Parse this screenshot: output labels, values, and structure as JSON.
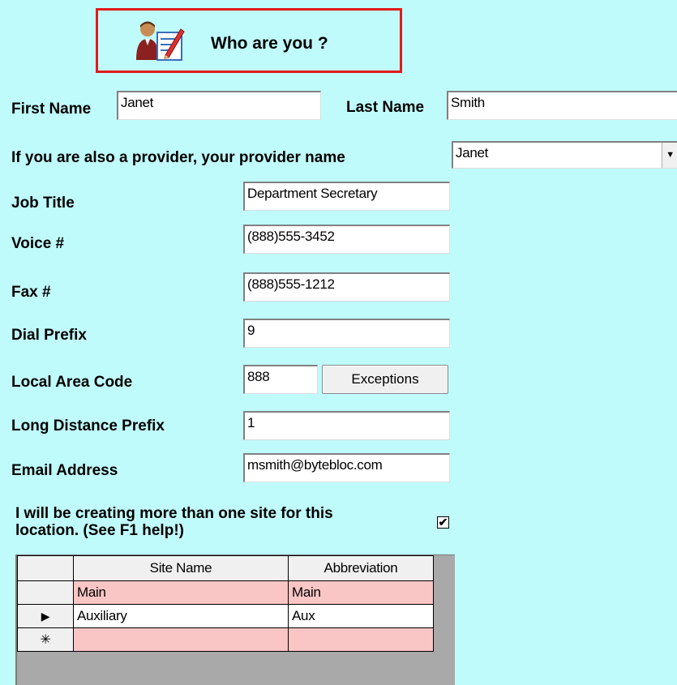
{
  "header": {
    "title": "Who are you ?",
    "icon": "person-editing-icon"
  },
  "labels": {
    "first_name": "First Name",
    "last_name": "Last Name",
    "provider": "If you are also a provider, your provider name",
    "job_title": "Job Title",
    "voice": "Voice #",
    "fax": "Fax #",
    "dial_prefix": "Dial Prefix",
    "local_area_code": "Local Area Code",
    "long_distance_prefix": "Long Distance Prefix",
    "email": "Email Address",
    "multi_site_line1": "I will be creating more than one site for this",
    "multi_site_line2": "location. (See F1 help!)"
  },
  "fields": {
    "first_name": "Janet",
    "last_name": "Smith",
    "provider": "Janet",
    "job_title": "Department Secretary",
    "voice": "(888)555-3452",
    "fax": "(888)555-1212",
    "dial_prefix": "9",
    "local_area_code": "888",
    "long_distance_prefix": "1",
    "email": "msmith@bytebloc.com"
  },
  "buttons": {
    "exceptions": "Exceptions"
  },
  "multi_site_checked": "✔",
  "grid": {
    "columns": [
      "Site Name",
      "Abbreviation"
    ],
    "rows": [
      {
        "indicator": "",
        "site_name": "Main",
        "abbreviation": "Main"
      },
      {
        "indicator": "▶",
        "site_name": "Auxiliary",
        "abbreviation": "Aux"
      },
      {
        "indicator": "✳",
        "site_name": "",
        "abbreviation": ""
      }
    ]
  },
  "colors": {
    "background": "#c0fbfb",
    "header_border": "#e11b1b",
    "row_pink": "#f9c5c5"
  }
}
